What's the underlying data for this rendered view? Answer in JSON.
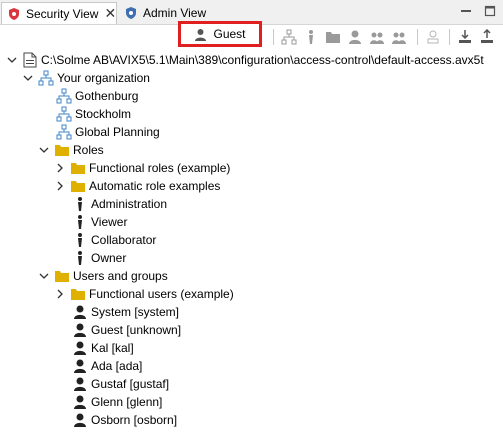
{
  "tabs": [
    {
      "label": "Security View",
      "icon": "security-shield-icon",
      "active": true
    },
    {
      "label": "Admin View",
      "icon": "admin-shield-icon",
      "active": false
    }
  ],
  "toolbar": {
    "current_user_label": "Guest",
    "highlight_color": "#e02020"
  },
  "tree": {
    "root_path": "C:\\Solme AB\\AVIX5\\5.1\\Main\\389\\configuration\\access-control\\default-access.avx5t",
    "organization": {
      "label": "Your organization",
      "children": [
        "Gothenburg",
        "Stockholm",
        "Global Planning"
      ]
    },
    "roles": {
      "label": "Roles",
      "folders": [
        "Functional roles (example)",
        "Automatic role examples"
      ],
      "items": [
        "Administration",
        "Viewer",
        "Collaborator",
        "Owner"
      ]
    },
    "users": {
      "label": "Users and groups",
      "folders": [
        "Functional users (example)"
      ],
      "items": [
        "System [system]",
        "Guest [unknown]",
        "Kal [kal]",
        "Ada [ada]",
        "Gustaf [gustaf]",
        "Glenn [glenn]",
        "Osborn [osborn]"
      ]
    }
  },
  "colors": {
    "folder": "#e0b000",
    "org": "#3f86c8",
    "tab_icon_red": "#d9343f",
    "tab_icon_blue": "#3f6fb0"
  }
}
